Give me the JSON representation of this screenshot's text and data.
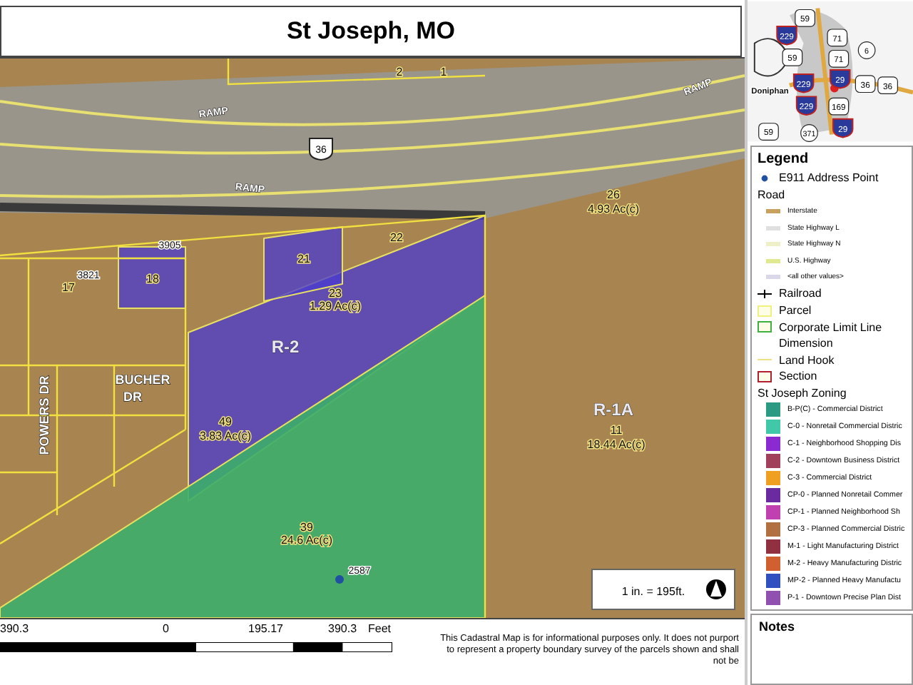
{
  "title": "St Joseph, MO",
  "locator": {
    "labels": [
      {
        "text": "59",
        "kind": "us"
      },
      {
        "text": "229",
        "kind": "interstate"
      },
      {
        "text": "71",
        "kind": "us"
      },
      {
        "text": "6",
        "kind": "state"
      },
      {
        "text": "59",
        "kind": "us"
      },
      {
        "text": "71",
        "kind": "us"
      },
      {
        "text": "Doniphan",
        "kind": "town"
      },
      {
        "text": "229",
        "kind": "interstate"
      },
      {
        "text": "29",
        "kind": "interstate"
      },
      {
        "text": "36",
        "kind": "us"
      },
      {
        "text": "36",
        "kind": "us"
      },
      {
        "text": "229",
        "kind": "interstate"
      },
      {
        "text": "169",
        "kind": "us"
      },
      {
        "text": "29",
        "kind": "interstate"
      },
      {
        "text": "59",
        "kind": "us"
      },
      {
        "text": "371",
        "kind": "state"
      }
    ]
  },
  "map": {
    "labels": [
      {
        "text": "RAMP",
        "kind": "road"
      },
      {
        "text": "RAMP",
        "kind": "road"
      },
      {
        "text": "RAMP",
        "kind": "road"
      },
      {
        "text": "36",
        "kind": "shield"
      },
      {
        "text": "26",
        "kind": "parcel"
      },
      {
        "text": "4.93 Ac(c)",
        "kind": "parcel"
      },
      {
        "text": "22",
        "kind": "parcel"
      },
      {
        "text": "21",
        "kind": "parcel"
      },
      {
        "text": "18",
        "kind": "parcel"
      },
      {
        "text": "3905",
        "kind": "address"
      },
      {
        "text": "23",
        "kind": "parcel"
      },
      {
        "text": "1.29 Ac(c)",
        "kind": "parcel"
      },
      {
        "text": "R-2",
        "kind": "zone"
      },
      {
        "text": "R-1A",
        "kind": "zone"
      },
      {
        "text": "11",
        "kind": "parcel"
      },
      {
        "text": "18.44 Ac(c)",
        "kind": "parcel"
      },
      {
        "text": "49",
        "kind": "parcel"
      },
      {
        "text": "3.83 Ac(c)",
        "kind": "parcel"
      },
      {
        "text": "BUCHER",
        "kind": "street"
      },
      {
        "text": "DR",
        "kind": "street"
      },
      {
        "text": "POWERS DR",
        "kind": "street_vertical"
      },
      {
        "text": "39",
        "kind": "parcel"
      },
      {
        "text": "24.6 Ac(c)",
        "kind": "parcel"
      },
      {
        "text": "2587",
        "kind": "address"
      },
      {
        "text": "17",
        "kind": "parcel"
      },
      {
        "text": "3821",
        "kind": "address"
      },
      {
        "text": "2",
        "kind": "parcel"
      },
      {
        "text": "1",
        "kind": "parcel"
      }
    ],
    "scale_note": "1 in. = 195ft."
  },
  "scale_bar": {
    "ticks": [
      "390.3",
      "0",
      "195.17",
      "390.3"
    ],
    "unit": "Feet"
  },
  "disclaimer": "This Cadastral Map is for informational purposes only.  It does not purport to represent a property boundary survey of the parcels shown and shall not be",
  "legend": {
    "title": "Legend",
    "items": [
      {
        "label": "E911 Address Point",
        "kind": "dot",
        "color": "#2050a0"
      },
      {
        "label": "Road",
        "kind": "heading"
      },
      {
        "label": "Interstate",
        "kind": "road",
        "color": "#c8a060"
      },
      {
        "label": "State Highway L",
        "kind": "road",
        "color": "#e0e0e0"
      },
      {
        "label": "State Highway N",
        "kind": "road",
        "color": "#f0f0c8"
      },
      {
        "label": "U.S. Highway",
        "kind": "road",
        "color": "#e0e890"
      },
      {
        "label": "<all other values>",
        "kind": "road",
        "color": "#d8d8e8"
      },
      {
        "label": "Railroad",
        "kind": "railroad"
      },
      {
        "label": "Parcel",
        "kind": "box",
        "color": "#f0f080"
      },
      {
        "label": "Corporate Limit Line",
        "kind": "box",
        "color": "#40b040"
      },
      {
        "label": "Dimension",
        "kind": "plain"
      },
      {
        "label": "Land Hook",
        "kind": "line",
        "color": "#f0e080"
      },
      {
        "label": "Section",
        "kind": "box",
        "color": "#b02030"
      },
      {
        "label": "St Joseph Zoning",
        "kind": "heading"
      },
      {
        "label": "B-P(C) - Commercial District",
        "kind": "zone",
        "color": "#2a9a82"
      },
      {
        "label": "C-0 - Nonretail Commercial Distric",
        "kind": "zone",
        "color": "#40c8a8"
      },
      {
        "label": "C-1 - Neighborhood Shopping Dis",
        "kind": "zone",
        "color": "#8a2ad0"
      },
      {
        "label": "C-2 - Downtown Business District",
        "kind": "zone",
        "color": "#a0405a"
      },
      {
        "label": "C-3 - Commercial District",
        "kind": "zone",
        "color": "#f0a020"
      },
      {
        "label": "CP-0 - Planned Nonretail Commer",
        "kind": "zone",
        "color": "#6a2aa0"
      },
      {
        "label": "CP-1 - Planned Neighborhood Sh",
        "kind": "zone",
        "color": "#c040b0"
      },
      {
        "label": "CP-3 - Planned Commercial Distric",
        "kind": "zone",
        "color": "#b07040"
      },
      {
        "label": "M-1 - Light Manufacturing District",
        "kind": "zone",
        "color": "#903040"
      },
      {
        "label": "M-2 - Heavy Manufacturing Distric",
        "kind": "zone",
        "color": "#d06030"
      },
      {
        "label": "MP-2 - Planned Heavy Manufactu",
        "kind": "zone",
        "color": "#3050c0"
      },
      {
        "label": "P-1 - Downtown Precise Plan Dist",
        "kind": "zone",
        "color": "#9050b0"
      }
    ]
  },
  "notes": {
    "title": "Notes"
  }
}
